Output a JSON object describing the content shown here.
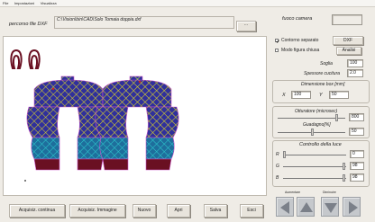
{
  "menu": [
    "File",
    "Impostazioni",
    "Visualizza"
  ],
  "path": {
    "label": "percorso file DXF",
    "value": "C:\\Vision\\bin\\CAD\\Solo Tomaia doppia.dxf",
    "browse_label": "..."
  },
  "focus": {
    "label": "fuoco camera",
    "value": ""
  },
  "options": {
    "contour_label": "Contorno separato",
    "contour_checked": true,
    "closed_label": "Modo figura chiusa",
    "closed_checked": false,
    "dxf_label": "DXF",
    "analyze_label": "Analisi"
  },
  "threshold": {
    "label": "Soglia",
    "value": "100"
  },
  "stitch": {
    "label": "Spessore cucitura",
    "value": "2.0"
  },
  "box": {
    "title": "Dimensione box [mm]",
    "x_label": "X",
    "x_value": "100",
    "y_label": "Y",
    "y_value": "50"
  },
  "camera": {
    "shutter_label": "Otturatore (microsec)",
    "shutter_value": "800",
    "shutter_level": 0.78,
    "gain_label": "Guadagno[%]",
    "gain_value": "50",
    "gain_level": 0.5
  },
  "light": {
    "title": "Controllo della luce",
    "channels": [
      {
        "name": "R",
        "value": "0",
        "level": 0.0
      },
      {
        "name": "G",
        "value": "98",
        "level": 0.98
      },
      {
        "name": "B",
        "value": "98",
        "level": 0.98
      }
    ]
  },
  "buttons": {
    "continuous": "Acquisiz. continua",
    "image": "Acquisiz. Immagine",
    "new": "Nuovo",
    "open": "Apri",
    "save": "Salva",
    "exit": "Esci"
  },
  "nav": {
    "raise_label": "Aumentare",
    "lower_label": "Diminuire"
  },
  "colors": {
    "pink": "#cc55cc",
    "navy": "#2f2f9c",
    "lime": "#b2e83e",
    "yellow": "#e0d020",
    "cyan": "#2cc6cc",
    "maroon": "#6a1022",
    "red": "#cc2020"
  }
}
